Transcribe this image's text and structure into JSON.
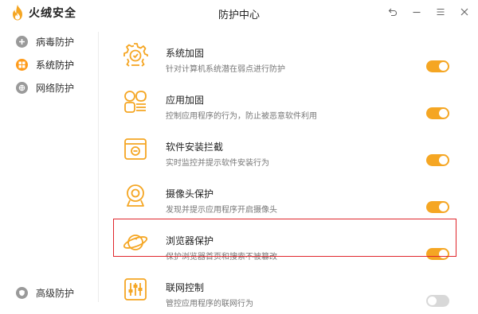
{
  "app": {
    "name": "火绒安全",
    "window_title": "防护中心"
  },
  "colors": {
    "accent": "#f5a623",
    "highlight_border": "#e0262c",
    "toggle_off": "#d8d8d8"
  },
  "window_controls": [
    {
      "name": "back-icon"
    },
    {
      "name": "minimize-icon"
    },
    {
      "name": "menu-icon"
    },
    {
      "name": "close-icon"
    }
  ],
  "sidebar": {
    "items": [
      {
        "label": "病毒防护",
        "icon": "plus-circle-icon",
        "active": false
      },
      {
        "label": "系统防护",
        "icon": "windows-icon",
        "active": true
      },
      {
        "label": "网络防护",
        "icon": "globe-icon",
        "active": false
      }
    ],
    "bottom_item": {
      "label": "高级防护",
      "icon": "shield-icon"
    }
  },
  "protections": [
    {
      "title": "系统加固",
      "desc": "针对计算机系统潜在弱点进行防护",
      "icon": "gear-icon",
      "enabled": true
    },
    {
      "title": "应用加固",
      "desc": "控制应用程序的行为，防止被恶意软件利用",
      "icon": "apps-icon",
      "enabled": true
    },
    {
      "title": "软件安装拦截",
      "desc": "实时监控并提示软件安装行为",
      "icon": "install-box-icon",
      "enabled": true
    },
    {
      "title": "摄像头保护",
      "desc": "发现并提示应用程序开启摄像头",
      "icon": "webcam-icon",
      "enabled": true
    },
    {
      "title": "浏览器保护",
      "desc": "保护浏览器首页和搜索不被篡改",
      "icon": "planet-icon",
      "enabled": true,
      "highlighted": true
    },
    {
      "title": "联网控制",
      "desc": "管控应用程序的联网行为",
      "icon": "sliders-icon",
      "enabled": false
    }
  ]
}
